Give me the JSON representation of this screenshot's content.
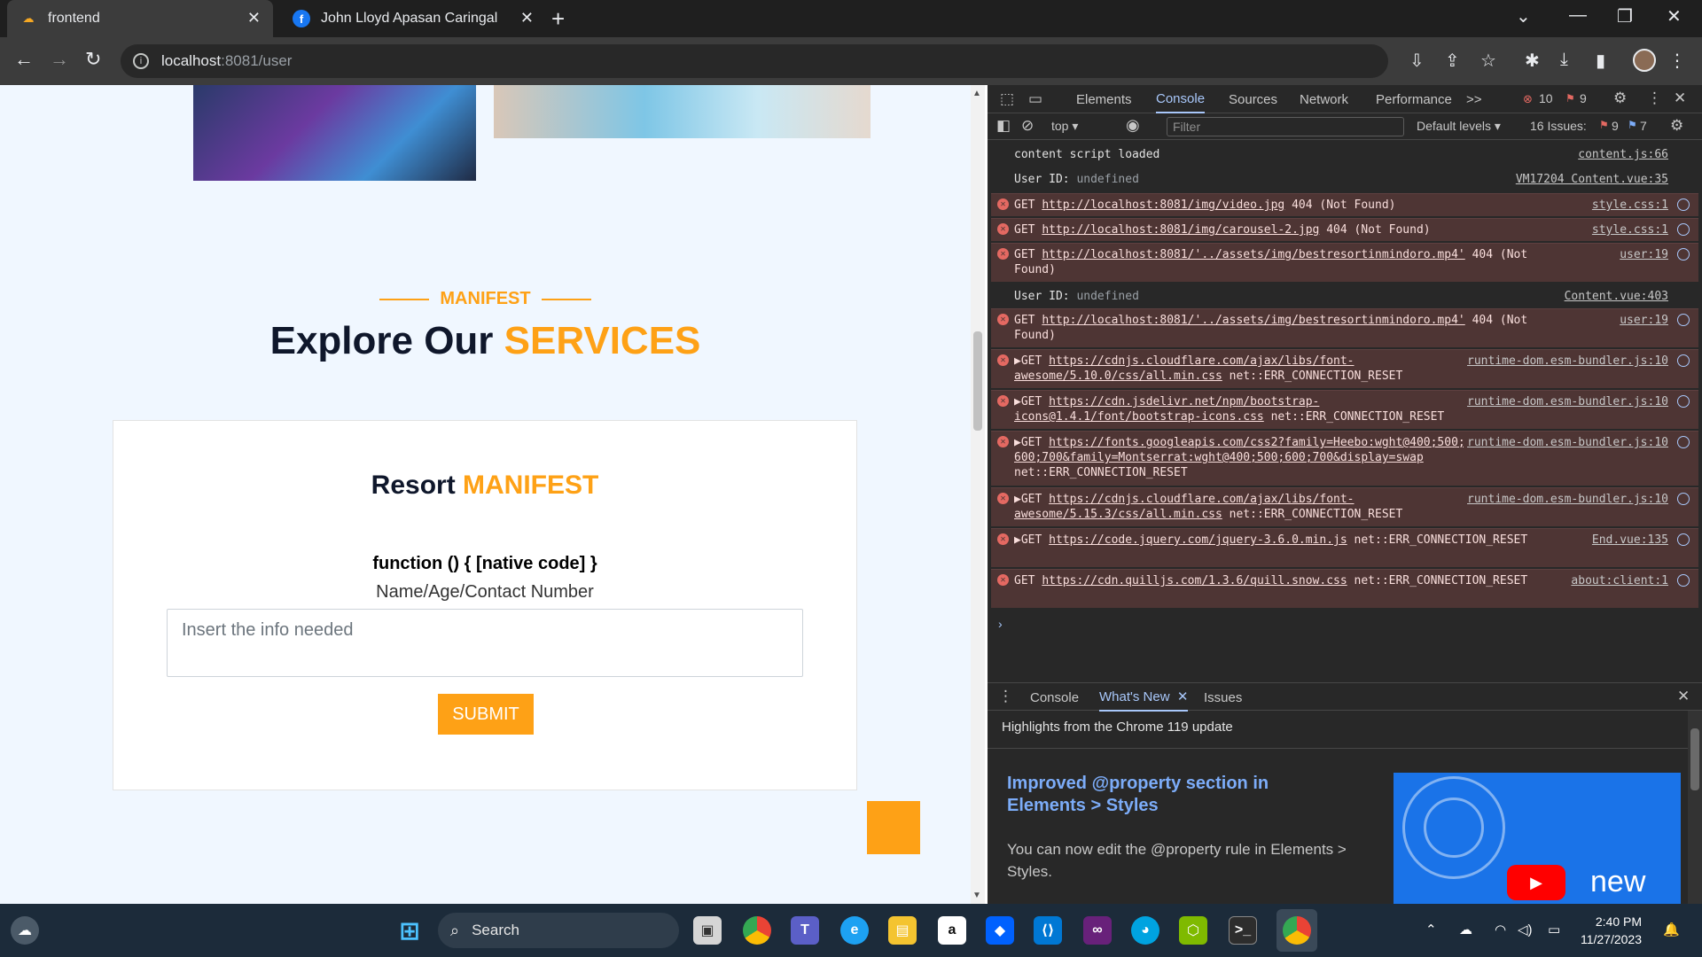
{
  "browser": {
    "tabs": [
      {
        "title": "frontend",
        "active": true
      },
      {
        "title": "John Lloyd Apasan Caringal",
        "active": false
      }
    ],
    "url_host": "localhost",
    "url_path": ":8081/user"
  },
  "page": {
    "section_subtitle": "MANIFEST",
    "title_main": "Explore Our ",
    "title_accent": "SERVICES",
    "card_title_main": "Resort ",
    "card_title_accent": "MANIFEST",
    "function_text": "function () { [native code] }",
    "field_label": "Name/Age/Contact Number",
    "textarea_placeholder": "Insert the info needed",
    "submit_label": "SUBMIT"
  },
  "devtools": {
    "tabs": [
      "Elements",
      "Console",
      "Sources",
      "Network",
      "Performance"
    ],
    "selected_tab": "Console",
    "more": ">>",
    "error_count": "10",
    "warning_count": "9",
    "context": "top",
    "filter_placeholder": "Filter",
    "levels": "Default levels",
    "issues_label": "16 Issues:",
    "issues_errors": "9",
    "issues_info": "7",
    "logs": [
      {
        "type": "info",
        "text": "content script loaded",
        "src": "content.js:66"
      },
      {
        "type": "info",
        "prefix": "User ID:",
        "text": "undefined",
        "src": "VM17204 Content.vue:35"
      },
      {
        "type": "err",
        "prefix": "GET",
        "link": "http://localhost:8081/img/video.jpg",
        "text": "404 (Not Found)",
        "src": "style.css:1"
      },
      {
        "type": "err",
        "prefix": "GET",
        "link": "http://localhost:8081/img/carousel-2.jpg",
        "text": "404 (Not Found)",
        "src": "style.css:1"
      },
      {
        "type": "err",
        "prefix": "GET",
        "link": "http://localhost:8081/'../assets/img/bestresortinmindoro.mp4'",
        "text": "404 (Not Found)",
        "src": "user:19"
      },
      {
        "type": "info",
        "prefix": "User ID:",
        "text": "undefined",
        "src": "Content.vue:403"
      },
      {
        "type": "err",
        "prefix": "GET",
        "link": "http://localhost:8081/'../assets/img/bestresortinmindoro.mp4'",
        "text": "404 (Not Found)",
        "src": "user:19"
      },
      {
        "type": "err",
        "prefix": "▶GET",
        "link": "https://cdnjs.cloudflare.com/ajax/libs/font-awesome/5.10.0/css/all.min.css",
        "text": "net::ERR_CONNECTION_RESET",
        "src": "runtime-dom.esm-bundler.js:10"
      },
      {
        "type": "err",
        "prefix": "▶GET",
        "link": "https://cdn.jsdelivr.net/npm/bootstrap-icons@1.4.1/font/bootstrap-icons.css",
        "text": "net::ERR_CONNECTION_RESET",
        "src": "runtime-dom.esm-bundler.js:10"
      },
      {
        "type": "err",
        "prefix": "▶GET",
        "link": "https://fonts.googleapis.com/css2?family=Heebo:wght@400;500;600;700&family=Montserrat:wght@400;500;600;700&display=swap",
        "text": "net::ERR_CONNECTION_RESET",
        "src": "runtime-dom.esm-bundler.js:10"
      },
      {
        "type": "err",
        "prefix": "▶GET",
        "link": "https://cdnjs.cloudflare.com/ajax/libs/font-awesome/5.15.3/css/all.min.css",
        "text": "net::ERR_CONNECTION_RESET",
        "src": "runtime-dom.esm-bundler.js:10"
      },
      {
        "type": "err",
        "prefix": "▶GET",
        "link": "https://code.jquery.com/jquery-3.6.0.min.js",
        "text": "net::ERR_CONNECTION_RESET",
        "src": "End.vue:135"
      },
      {
        "type": "err",
        "prefix": "GET",
        "link": "https://cdn.quilljs.com/1.3.6/quill.snow.css",
        "text": "net::ERR_CONNECTION_RESET",
        "src": "about:client:1"
      }
    ],
    "drawer": {
      "tabs": [
        "Console",
        "What's New",
        "Issues"
      ],
      "selected": "What's New",
      "highlights": "Highlights from the Chrome 119 update",
      "feature_title": "Improved @property section in Elements > Styles",
      "feature_text": "You can now edit the @property rule in Elements > Styles.",
      "video_label": "new"
    }
  },
  "taskbar": {
    "search_label": "Search",
    "time": "2:40 PM",
    "date": "11/27/2023"
  },
  "colors": {
    "accent": "#fea116",
    "dark": "#0f172b",
    "error_bg": "#4e3534"
  }
}
